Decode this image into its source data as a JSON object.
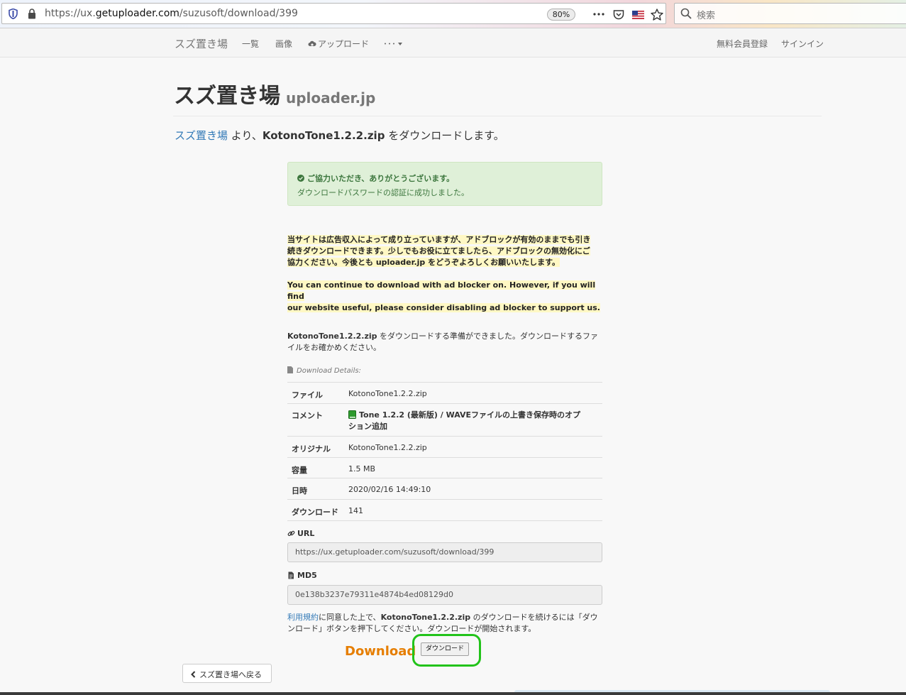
{
  "browser": {
    "url_prefix": "https://ux.",
    "url_domain": "getuploader.com",
    "url_path": "/suzusoft/download/399",
    "zoom": "80%",
    "search_placeholder": "検索"
  },
  "nav": {
    "brand": "スズ置き場",
    "items": [
      "一覧",
      "画像",
      "アップロード",
      "･･･"
    ],
    "right": [
      "無料会員登録",
      "サインイン"
    ]
  },
  "header": {
    "title": "スズ置き場",
    "subtitle": "uploader.jp"
  },
  "lead": {
    "owner_link": "スズ置き場",
    "middle": " より、",
    "filename": "KotonoTone1.2.2.zip",
    "tail": " をダウンロードします。"
  },
  "alert": {
    "title": "ご協力いただき、ありがとうございます。",
    "message": "ダウンロードパスワードの認証に成功しました。"
  },
  "adnote": {
    "jp_line1": "当サイトは広告収入によって成り立っていますが、アドブロックが有効のままでも引き",
    "jp_line2": "続きダウンロードできます。少しでもお役に立てましたら、アドブロックの無効化にご",
    "jp_line3": "協力ください。今後とも uploader.jp をどうぞよろしくお願いいたします。",
    "en_line1": "You can continue to download with ad blocker on. However, if you will find",
    "en_line2": "our website useful, please consider disabling ad blocker to support us."
  },
  "prep": {
    "filename": "KotonoTone1.2.2.zip",
    "text1": " をダウンロードする準備ができました。ダウンロードするファ",
    "text2": "イルをお確かめください。"
  },
  "details": {
    "caption": "Download Details:",
    "rows": [
      {
        "key": "ファイル",
        "value": "KotonoTone1.2.2.zip"
      },
      {
        "key": "コメント",
        "value": "Tone 1.2.2 (最新版) / WAVEファイルの上書き保存時のオプ",
        "value2": "ション追加"
      },
      {
        "key": "オリジナル",
        "value": "KotonoTone1.2.2.zip"
      },
      {
        "key": "容量",
        "value": "1.5 MB"
      },
      {
        "key": "日時",
        "value": "2020/02/16 14:49:10"
      },
      {
        "key": "ダウンロード",
        "value": "141"
      }
    ]
  },
  "url_field": {
    "label": "URL",
    "value": "https://ux.getuploader.com/suzusoft/download/399"
  },
  "md5_field": {
    "label": "MD5",
    "value": "0e138b3237e79311e4874b4ed08129d0"
  },
  "terms": {
    "link": "利用規約",
    "text1": "に同意した上で、",
    "filename": "KotonoTone1.2.2.zip",
    "text2": " のダウンロードを続けるには「ダウ",
    "text3": "ンロード」ボタンを押下してください。ダウンロードが開始されます。"
  },
  "download": {
    "heading": "Download",
    "button": "ダウンロード"
  },
  "back_button": "スズ置き場へ戻る",
  "colors": {
    "link": "#337ab7",
    "download_heading": "#e67e00",
    "highlight_ring": "#22c31a",
    "alert_bg": "#dff0d8"
  }
}
